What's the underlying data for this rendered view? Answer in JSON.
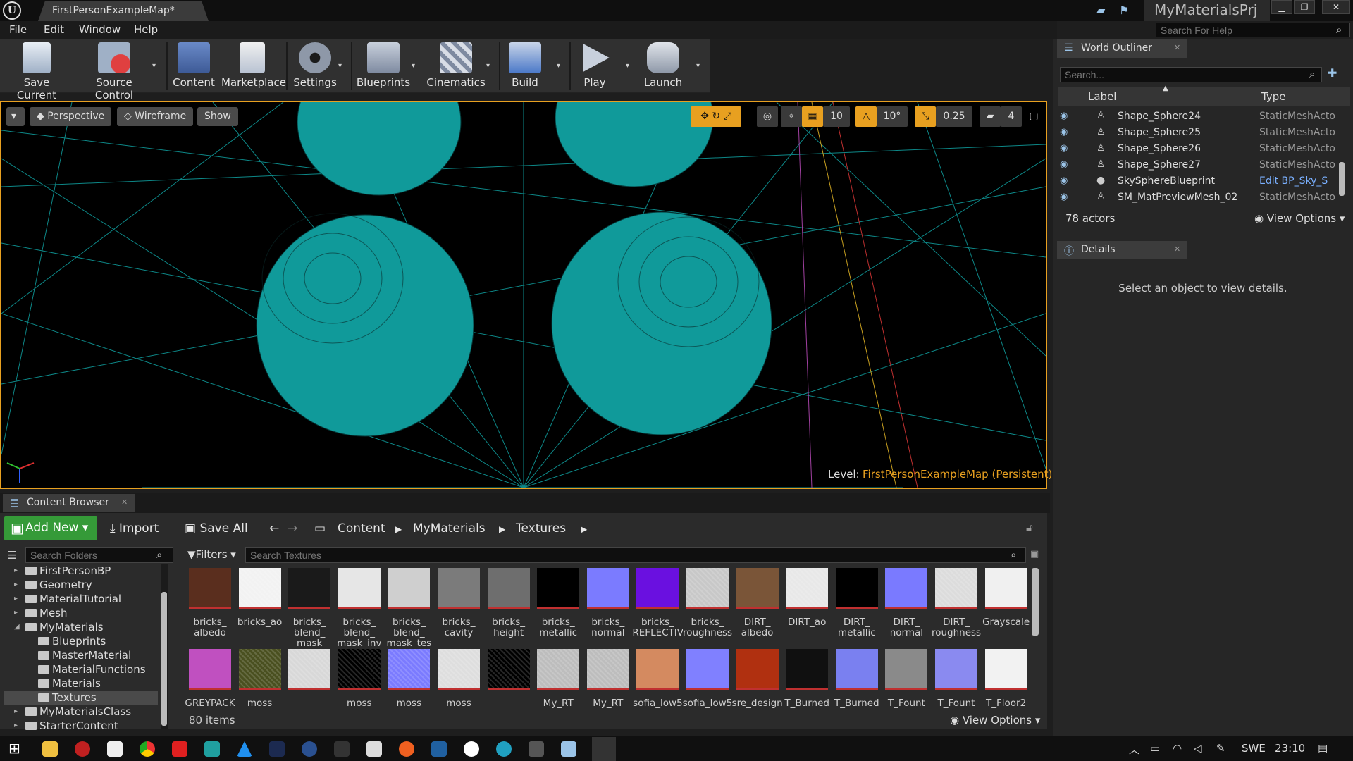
{
  "title_bar": {
    "map_tab": "FirstPersonExampleMap*",
    "project": "MyMaterialsPrj"
  },
  "menu": [
    "File",
    "Edit",
    "Window",
    "Help"
  ],
  "help_search_placeholder": "Search For Help",
  "toolbar": [
    "Save Current",
    "Source Control",
    "Content",
    "Marketplace",
    "Settings",
    "Blueprints",
    "Cinematics",
    "Build",
    "Play",
    "Launch"
  ],
  "viewport": {
    "buttons": [
      "Perspective",
      "Wireframe",
      "Show"
    ],
    "grid_snap": "10",
    "rotation_snap": "10°",
    "scale_snap": "0.25",
    "camera_speed": "4",
    "level_label": "Level:",
    "level_name": "FirstPersonExampleMap (Persistent)"
  },
  "world_outliner": {
    "tab": "World Outliner",
    "search_placeholder": "Search...",
    "col_label": "Label",
    "col_type": "Type",
    "rows": [
      {
        "label": "Shape_Sphere24",
        "type": "StaticMeshActo"
      },
      {
        "label": "Shape_Sphere25",
        "type": "StaticMeshActo"
      },
      {
        "label": "Shape_Sphere26",
        "type": "StaticMeshActo"
      },
      {
        "label": "Shape_Sphere27",
        "type": "StaticMeshActo"
      },
      {
        "label": "SkySphereBlueprint",
        "type": "Edit BP_Sky_S"
      },
      {
        "label": "SM_MatPreviewMesh_02",
        "type": "StaticMeshActo"
      }
    ],
    "actors": "78 actors",
    "view_options": "View Options"
  },
  "details": {
    "tab": "Details",
    "message": "Select an object to view details."
  },
  "content_browser": {
    "tab": "Content Browser",
    "add_new": "Add New",
    "import": "Import",
    "save_all": "Save All",
    "path": [
      "Content",
      "MyMaterials",
      "Textures"
    ],
    "filters": "Filters",
    "folder_search_placeholder": "Search Folders",
    "texture_search_placeholder": "Search Textures",
    "folders": [
      {
        "name": "FirstPersonBP",
        "depth": 0,
        "arrow": "▸"
      },
      {
        "name": "Geometry",
        "depth": 0,
        "arrow": "▸"
      },
      {
        "name": "MaterialTutorial",
        "depth": 0,
        "arrow": "▸"
      },
      {
        "name": "Mesh",
        "depth": 0,
        "arrow": "▸"
      },
      {
        "name": "MyMaterials",
        "depth": 0,
        "arrow": "◢"
      },
      {
        "name": "Blueprints",
        "depth": 1,
        "arrow": ""
      },
      {
        "name": "MasterMaterial",
        "depth": 1,
        "arrow": ""
      },
      {
        "name": "MaterialFunctions",
        "depth": 1,
        "arrow": ""
      },
      {
        "name": "Materials",
        "depth": 1,
        "arrow": ""
      },
      {
        "name": "Textures",
        "depth": 1,
        "arrow": "",
        "selected": true
      },
      {
        "name": "MyMaterialsClass",
        "depth": 0,
        "arrow": "▸"
      },
      {
        "name": "StarterContent",
        "depth": 0,
        "arrow": "▸"
      }
    ],
    "assets_row1": [
      {
        "name": "bricks_\nalbedo",
        "color": "#5a2e1e"
      },
      {
        "name": "bricks_ao",
        "color": "#f2f2f2"
      },
      {
        "name": "bricks_\nblend_\nmask",
        "color": "#1a1a1a"
      },
      {
        "name": "bricks_\nblend_\nmask_inv",
        "color": "#e6e6e6"
      },
      {
        "name": "bricks_\nblend_\nmask_tes",
        "color": "#cfcfcf"
      },
      {
        "name": "bricks_\ncavity",
        "color": "#7b7b7b"
      },
      {
        "name": "bricks_\nheight",
        "color": "#6e6e6e"
      },
      {
        "name": "bricks_\nmetallic",
        "color": "#000000"
      },
      {
        "name": "bricks_\nnormal",
        "color": "#7b7bff"
      },
      {
        "name": "bricks_\nREFLECTIV",
        "color": "#6a10e0"
      },
      {
        "name": "bricks_\nroughness",
        "color": "#c8c8c8"
      },
      {
        "name": "DIRT_\nalbedo",
        "color": "#7a5538"
      },
      {
        "name": "DIRT_ao",
        "color": "#e8e8e8"
      },
      {
        "name": "DIRT_\nmetallic",
        "color": "#000000"
      },
      {
        "name": "DIRT_\nnormal",
        "color": "#7a7aff"
      },
      {
        "name": "DIRT_\nroughness",
        "color": "#dcdcdc"
      },
      {
        "name": "Grayscale",
        "color": "#f0f0f0"
      }
    ],
    "assets_row2": [
      {
        "name": "GREYPACK",
        "color": "#c050c0"
      },
      {
        "name": "moss",
        "color": "#4a5020"
      },
      {
        "name": "",
        "color": "#d8d8d8"
      },
      {
        "name": "moss",
        "color": "#000000"
      },
      {
        "name": "moss",
        "color": "#7b7bff"
      },
      {
        "name": "moss",
        "color": "#dedede"
      },
      {
        "name": "",
        "color": "#000000"
      },
      {
        "name": "My_RT",
        "color": "#bdbdbd"
      },
      {
        "name": "My_RT",
        "color": "#bdbdbd"
      },
      {
        "name": "sofia_low5",
        "color": "#d48a60"
      },
      {
        "name": "sofia_low5",
        "color": "#8080ff"
      },
      {
        "name": "sre_design",
        "color": "#b03010"
      },
      {
        "name": "T_Burned",
        "color": "#101010"
      },
      {
        "name": "T_Burned",
        "color": "#7a80f0"
      },
      {
        "name": "T_Fount",
        "color": "#8a8a8a"
      },
      {
        "name": "T_Fount",
        "color": "#8a8af0"
      },
      {
        "name": "T_Floor2",
        "color": "#f2f2f2"
      }
    ],
    "item_count": "80 items",
    "view_options": "View Options"
  },
  "taskbar": {
    "language": "SWE",
    "time": "23:10"
  },
  "colors": {
    "accent": "#e8a020",
    "wire": "#10a0a0",
    "add_new": "#359a38"
  }
}
